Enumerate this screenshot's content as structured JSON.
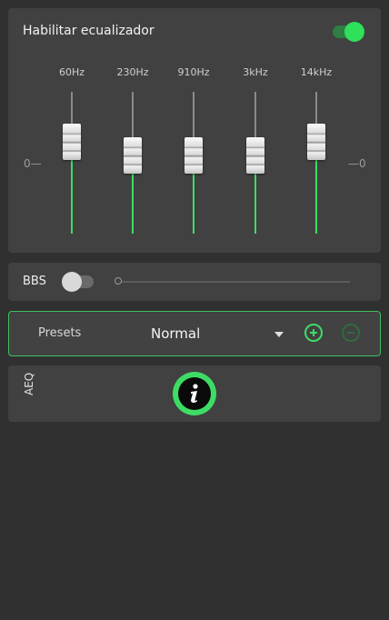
{
  "equalizer": {
    "title": "Habilitar ecualizador",
    "enabled": true,
    "zero_left": "0",
    "zero_right": "0",
    "bands": [
      {
        "freq": "60Hz",
        "level": 0.3
      },
      {
        "freq": "230Hz",
        "level": 0.1
      },
      {
        "freq": "910Hz",
        "level": 0.1
      },
      {
        "freq": "3kHz",
        "level": 0.1
      },
      {
        "freq": "14kHz",
        "level": 0.3
      }
    ]
  },
  "bbs": {
    "label": "BBS",
    "enabled": false,
    "level": 0
  },
  "presets": {
    "label": "Presets",
    "selected": "Normal"
  },
  "aeq": {
    "label": "AEQ"
  },
  "colors": {
    "accent": "#3ddc64",
    "background": "#303030",
    "card": "#414141"
  },
  "icons": {
    "add": "plus-circle-icon",
    "remove": "minus-circle-icon",
    "info": "info-icon"
  }
}
